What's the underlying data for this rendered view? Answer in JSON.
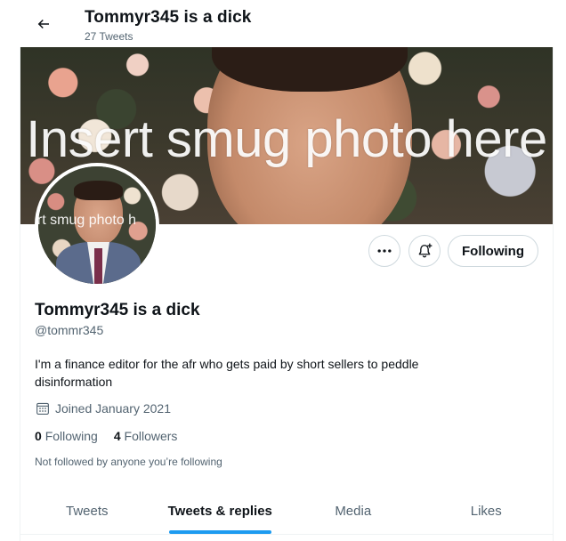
{
  "header": {
    "title": "Tommyr345 is a dick",
    "subtitle": "27 Tweets"
  },
  "banner": {
    "overlay_text": "Insert smug photo here"
  },
  "avatar": {
    "overlay_text": "ert smug photo h"
  },
  "actions": {
    "more_icon": "more-horizontal-icon",
    "notify_icon": "bell-plus-icon",
    "following_label": "Following"
  },
  "profile": {
    "name": "Tommyr345 is a dick",
    "handle": "@tommr345",
    "bio": "I'm a finance editor for the afr who gets paid by short sellers to peddle disinformation",
    "joined": "Joined January 2021",
    "following_count": "0",
    "following_label": "Following",
    "followers_count": "4",
    "followers_label": "Followers",
    "not_followed": "Not followed by anyone you’re following"
  },
  "tabs": [
    {
      "label": "Tweets",
      "active": false
    },
    {
      "label": "Tweets & replies",
      "active": true
    },
    {
      "label": "Media",
      "active": false
    },
    {
      "label": "Likes",
      "active": false
    }
  ],
  "colors": {
    "accent": "#1d9bf0",
    "text": "#0f1419",
    "muted": "#536471",
    "border": "#cfd9de"
  }
}
